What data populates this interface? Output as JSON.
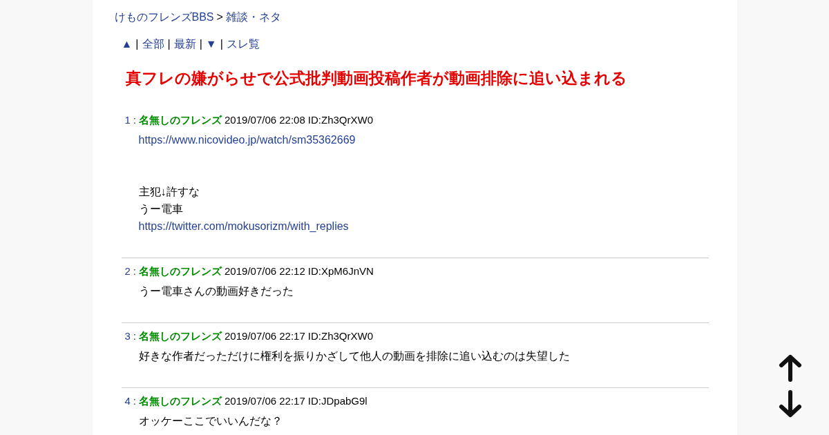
{
  "breadcrumb": [
    {
      "kind": "link",
      "text": "けものフレンズBBS"
    },
    {
      "kind": "text",
      "text": ">"
    },
    {
      "kind": "link",
      "text": "雑談・ネタ"
    }
  ],
  "nav": [
    {
      "kind": "link",
      "text": "▲"
    },
    {
      "kind": "separator",
      "text": "|"
    },
    {
      "kind": "link",
      "text": "全部"
    },
    {
      "kind": "separator",
      "text": "|"
    },
    {
      "kind": "link",
      "text": "最新"
    },
    {
      "kind": "separator",
      "text": "|"
    },
    {
      "kind": "link",
      "text": "▼"
    },
    {
      "kind": "separator",
      "text": "|"
    },
    {
      "kind": "link",
      "text": "スレ覧"
    }
  ],
  "thread_title": "真フレの嫌がらせで公式批判動画投稿作者が動画排除に追い込まれる",
  "posts": [
    {
      "number": "1",
      "separator": ":",
      "name": "名無しのフレンズ",
      "date": "2019/07/06 22:08",
      "id": "ID:Zh3QrXW0",
      "body": [
        [
          {
            "kind": "link",
            "text": "https://www.nicovideo.jp/watch/sm35362669"
          }
        ],
        [
          {
            "kind": "text",
            "text": "主犯↓許すな"
          },
          {
            "kind": "text",
            "text": "うー電車"
          },
          {
            "kind": "link",
            "text": "https://twitter.com/mokusorizm/with_replies"
          }
        ]
      ]
    },
    {
      "number": "2",
      "separator": ":",
      "name": "名無しのフレンズ",
      "date": "2019/07/06 22:12",
      "id": "ID:XpM6JnVN",
      "body": [
        [
          {
            "kind": "text",
            "text": "うー電車さんの動画好きだった"
          }
        ]
      ]
    },
    {
      "number": "3",
      "separator": ":",
      "name": "名無しのフレンズ",
      "date": "2019/07/06 22:17",
      "id": "ID:Zh3QrXW0",
      "body": [
        [
          {
            "kind": "text",
            "text": "好きな作者だっただけに権利を振りかざして他人の動画を排除に追い込むのは失望した"
          }
        ]
      ]
    },
    {
      "number": "4",
      "separator": ":",
      "name": "名無しのフレンズ",
      "date": "2019/07/06 22:17",
      "id": "ID:JDpabG9l",
      "body": [
        [
          {
            "kind": "text",
            "text": "オッケーここでいいんだな？"
          }
        ]
      ]
    }
  ]
}
